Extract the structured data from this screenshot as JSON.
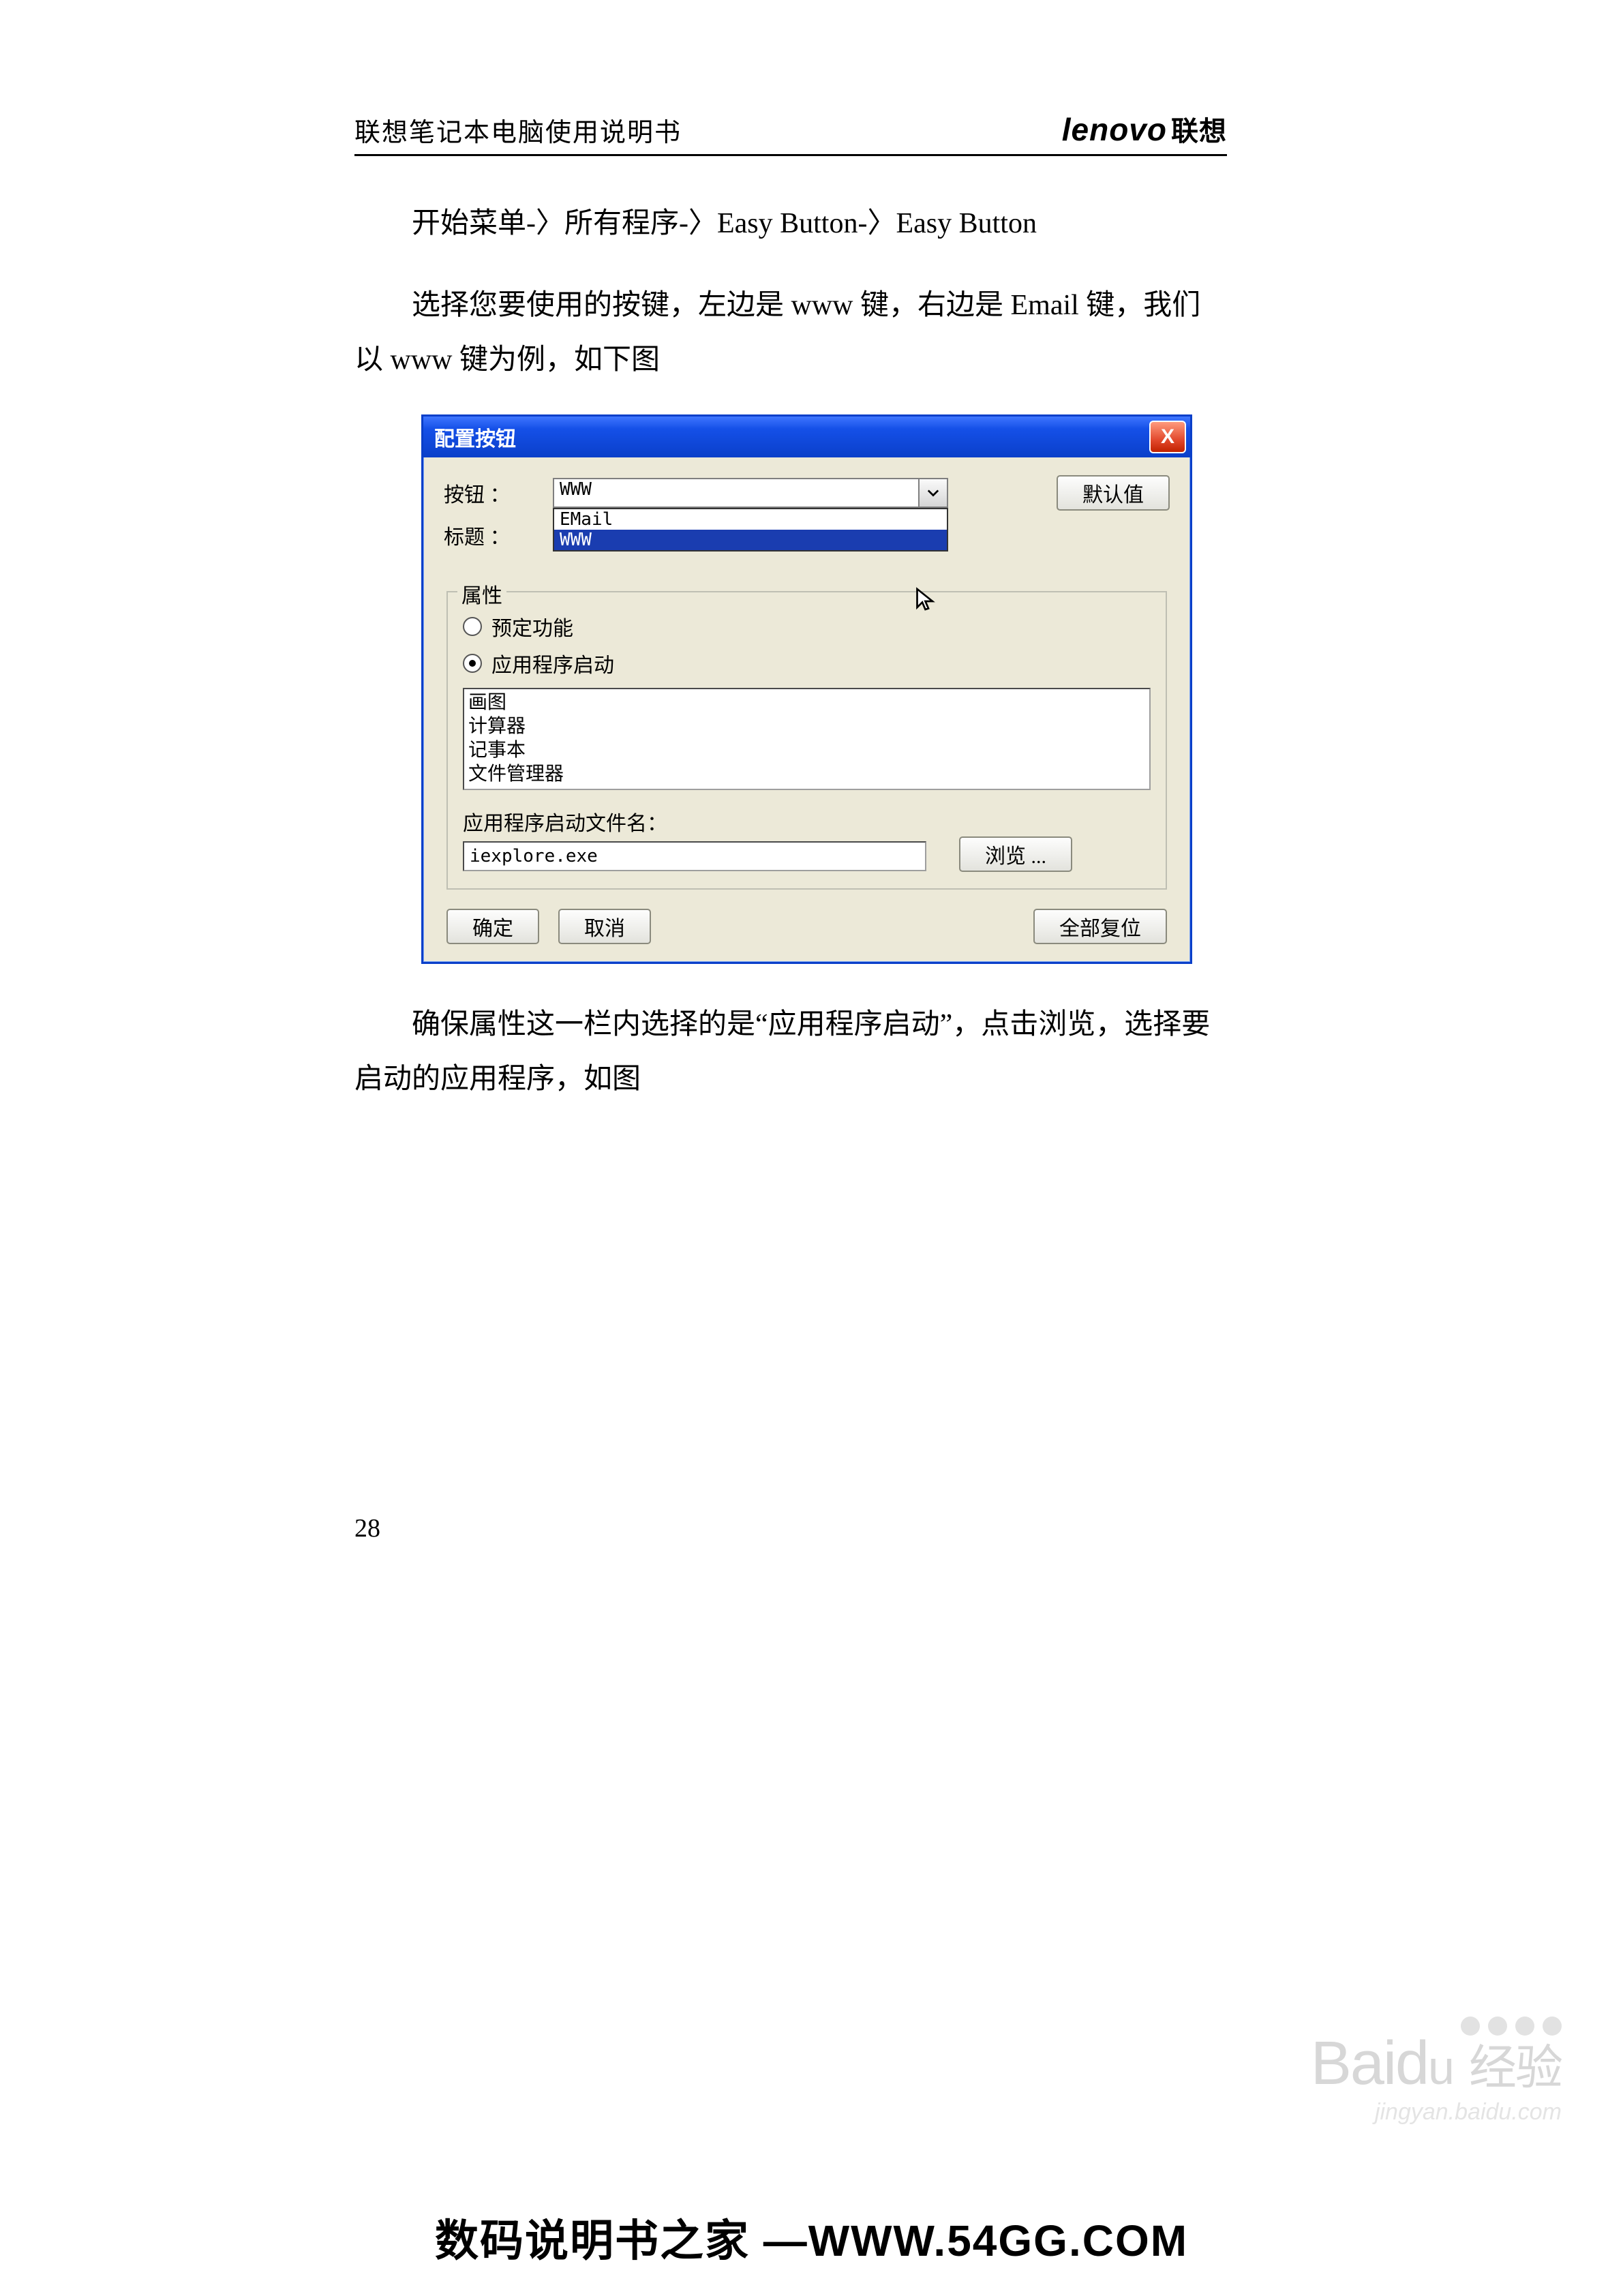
{
  "header": {
    "title": "联想笔记本电脑使用说明书",
    "brand_en": "lenovo",
    "brand_cn": "联想"
  },
  "paragraphs": {
    "p1": "开始菜单-〉所有程序-〉Easy Button-〉Easy Button",
    "p2": "选择您要使用的按键，左边是 www 键，右边是 Email 键，我们以 www 键为例，如下图",
    "p3": "确保属性这一栏内选择的是“应用程序启动”，点击浏览，选择要启动的应用程序，如图"
  },
  "dialog": {
    "title": "配置按钮",
    "close_tooltip": "X",
    "labels": {
      "button": "按钮  ：",
      "caption": "标题  ：",
      "properties": "属性",
      "radio_preset": "预定功能",
      "radio_launch": "应用程序启动",
      "launch_file": "应用程序启动文件名：",
      "default": "默认值",
      "browse": "浏览 ...",
      "ok": "确定",
      "cancel": "取消",
      "reset_all": "全部复位"
    },
    "combo_value": "WWW",
    "dropdown_options": [
      "EMail",
      "WWW"
    ],
    "dropdown_selected_index": 1,
    "list_items": [
      "画图",
      "计算器",
      "记事本",
      "文件管理器"
    ],
    "file_value": "iexplore.exe"
  },
  "page_number": "28",
  "watermark": {
    "brand": "Baid",
    "brand_exp": "经验",
    "sub": "jingyan.baidu.com"
  },
  "footer_site": "数码说明书之家 —WWW.54GG.COM"
}
